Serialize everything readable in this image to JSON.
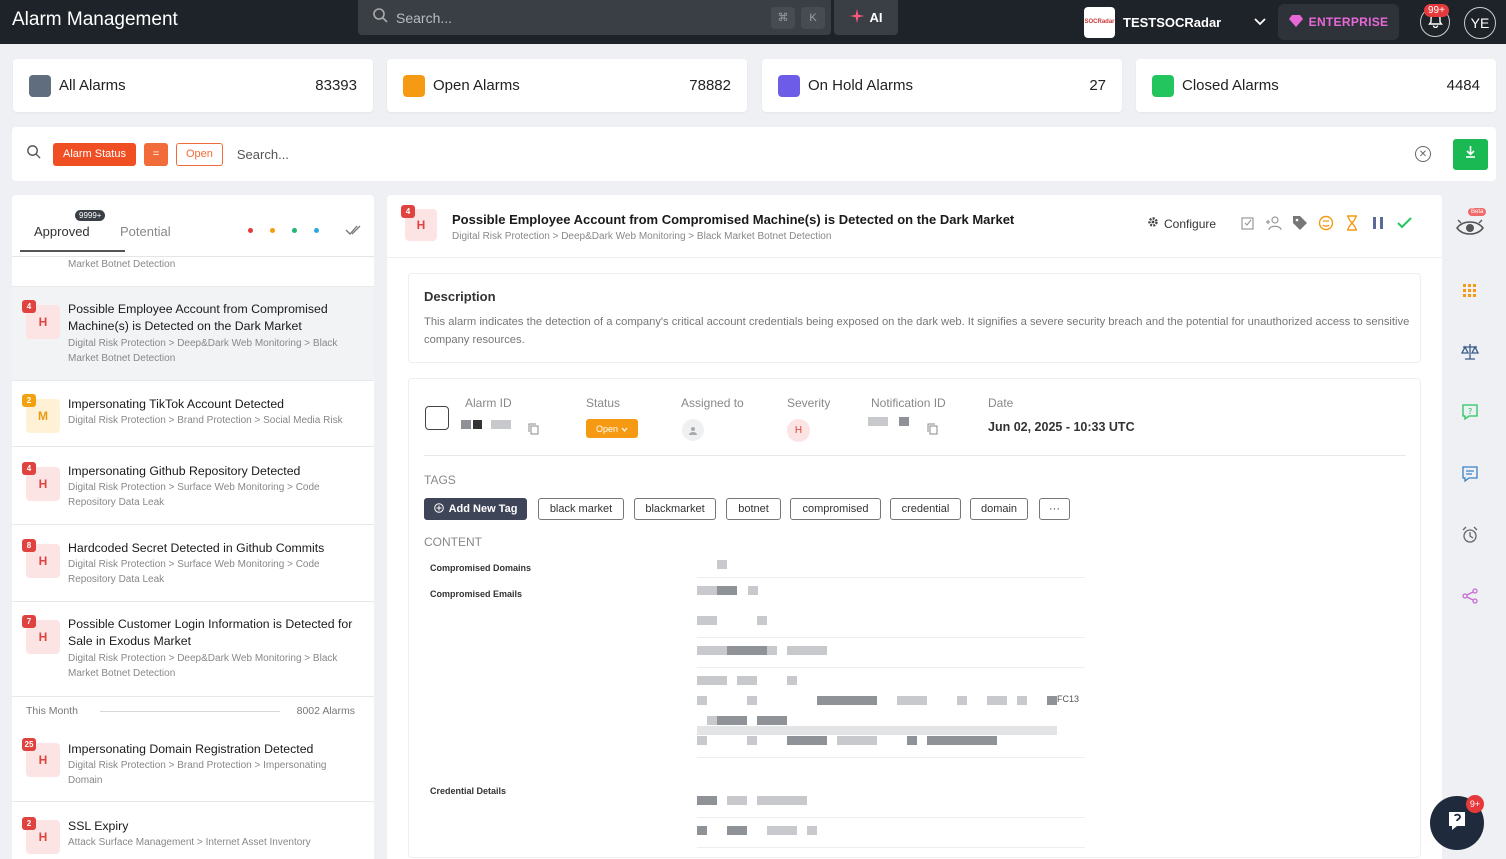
{
  "topbar": {
    "title": "Alarm Management",
    "search_placeholder": "Search...",
    "shortcut_cmd": "⌘",
    "shortcut_k": "K",
    "ai_label": "AI",
    "org_name": "TESTSOCRadar",
    "org_logo_text": "SOCRadar",
    "plan_label": "ENTERPRISE",
    "notification_badge": "99+",
    "user_initials": "YE"
  },
  "stats": [
    {
      "label": "All Alarms",
      "value": "83393",
      "color": "#5f6d7e"
    },
    {
      "label": "Open Alarms",
      "value": "78882",
      "color": "#f59a12"
    },
    {
      "label": "On Hold Alarms",
      "value": "27",
      "color": "#6c5ce7"
    },
    {
      "label": "Closed Alarms",
      "value": "4484",
      "color": "#22c55e"
    }
  ],
  "filter": {
    "field": "Alarm Status",
    "operator": "=",
    "value": "Open",
    "search_placeholder": "Search..."
  },
  "list": {
    "tab_approved": "Approved",
    "tab_approved_badge": "9999+",
    "tab_potential": "Potential",
    "partial_path": "Market Botnet Detection",
    "month_label": "This Month",
    "month_count": "8002 Alarms",
    "items": [
      {
        "count": "4",
        "severity": "H",
        "title": "Possible Employee Account from Compromised Machine(s) is Detected on the Dark Market",
        "path": "Digital Risk Protection > Deep&Dark Web Monitoring > Black Market Botnet Detection"
      },
      {
        "count": "2",
        "severity": "M",
        "title": "Impersonating TikTok Account Detected",
        "path": "Digital Risk Protection > Brand Protection > Social Media Risk"
      },
      {
        "count": "4",
        "severity": "H",
        "title": "Impersonating Github Repository Detected",
        "path": "Digital Risk Protection > Surface Web Monitoring > Code Repository Data Leak"
      },
      {
        "count": "8",
        "severity": "H",
        "title": "Hardcoded Secret Detected in Github Commits",
        "path": "Digital Risk Protection > Surface Web Monitoring > Code Repository Data Leak"
      },
      {
        "count": "7",
        "severity": "H",
        "title": "Possible Customer Login Information is Detected for Sale in Exodus Market",
        "path": "Digital Risk Protection > Deep&Dark Web Monitoring > Black Market Botnet Detection"
      },
      {
        "count": "25",
        "severity": "H",
        "title": "Impersonating Domain Registration Detected",
        "path": "Digital Risk Protection > Brand Protection > Impersonating Domain"
      },
      {
        "count": "2",
        "severity": "H",
        "title": "SSL Expiry",
        "path": "Attack Surface Management > Internet Asset Inventory"
      }
    ]
  },
  "detail": {
    "count": "4",
    "severity": "H",
    "title": "Possible Employee Account from Compromised Machine(s) is Detected on the Dark Market",
    "path": "Digital Risk Protection > Deep&Dark Web Monitoring > Black Market Botnet Detection",
    "configure_label": "Configure",
    "description_heading": "Description",
    "description_text": "This alarm indicates the detection of a company's critical account credentials being exposed on the dark web. It signifies a severe security breach and the potential for unauthorized access to sensitive company resources.",
    "labels": {
      "alarm_id": "Alarm ID",
      "status": "Status",
      "assigned_to": "Assigned to",
      "severity": "Severity",
      "notification_id": "Notification ID",
      "date": "Date"
    },
    "status_value": "Open",
    "severity_value": "H",
    "date_value": "Jun 02, 2025 - 10:33 UTC",
    "tags_heading": "TAGS",
    "add_tag_label": "Add New Tag",
    "tags": [
      "black market",
      "blackmarket",
      "botnet",
      "compromised",
      "credential",
      "domain",
      "···"
    ],
    "content_heading": "CONTENT",
    "content_labels": [
      "Compromised Domains",
      "Compromised Emails",
      "Credential Details"
    ],
    "content_snippet": "FC13"
  },
  "sidebar": {
    "beta_label": "Beta",
    "help_badge": "9+"
  }
}
